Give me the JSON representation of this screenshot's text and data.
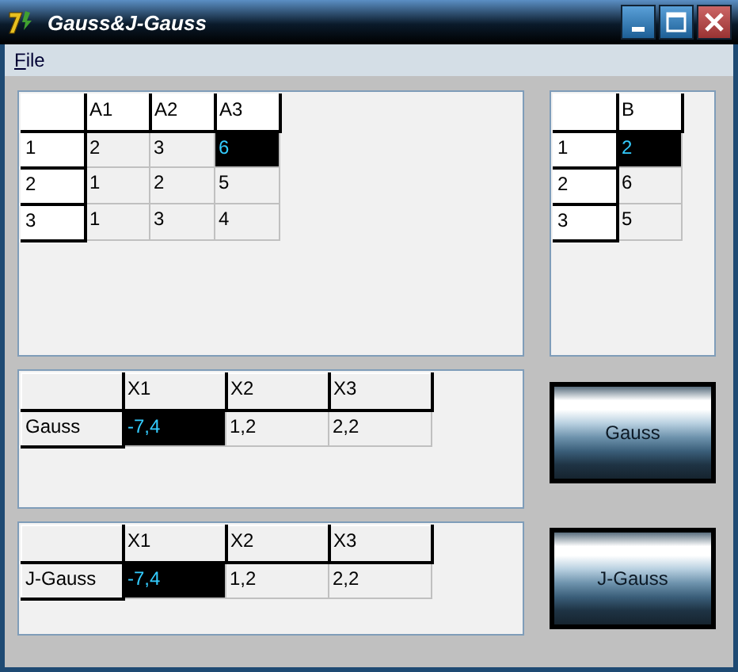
{
  "window": {
    "title": "Gauss&J-Gauss"
  },
  "menu": [
    {
      "label": "File"
    }
  ],
  "grids": [
    {
      "columns": [
        "A1",
        "A2",
        "A3"
      ],
      "rows": [
        {
          "header": "1",
          "cells": [
            {
              "text": "2",
              "selected": false
            },
            {
              "text": "3",
              "selected": false
            },
            {
              "text": "6",
              "selected": true
            }
          ]
        },
        {
          "header": "2",
          "cells": [
            {
              "text": "1",
              "selected": false
            },
            {
              "text": "2",
              "selected": false
            },
            {
              "text": "5",
              "selected": false
            }
          ]
        },
        {
          "header": "3",
          "cells": [
            {
              "text": "1",
              "selected": false
            },
            {
              "text": "3",
              "selected": false
            },
            {
              "text": "4",
              "selected": false
            }
          ]
        }
      ]
    },
    {
      "columns": [
        "B"
      ],
      "rows": [
        {
          "header": "1",
          "cells": [
            {
              "text": "2",
              "selected": true
            }
          ]
        },
        {
          "header": "2",
          "cells": [
            {
              "text": "6",
              "selected": false
            }
          ]
        },
        {
          "header": "3",
          "cells": [
            {
              "text": "5",
              "selected": false
            }
          ]
        }
      ]
    },
    {
      "columns": [
        "X1",
        "X2",
        "X3"
      ],
      "rows": [
        {
          "header": "Gauss",
          "cells": [
            {
              "text": "-7,4",
              "selected": true
            },
            {
              "text": "1,2",
              "selected": false
            },
            {
              "text": "2,2",
              "selected": false
            }
          ]
        }
      ]
    },
    {
      "columns": [
        "X1",
        "X2",
        "X3"
      ],
      "rows": [
        {
          "header": "J-Gauss",
          "cells": [
            {
              "text": "-7,4",
              "selected": true
            },
            {
              "text": "1,2",
              "selected": false
            },
            {
              "text": "2,2",
              "selected": false
            }
          ]
        }
      ]
    }
  ],
  "buttons": [
    {
      "label": "Gauss"
    },
    {
      "label": "J-Gauss"
    }
  ]
}
